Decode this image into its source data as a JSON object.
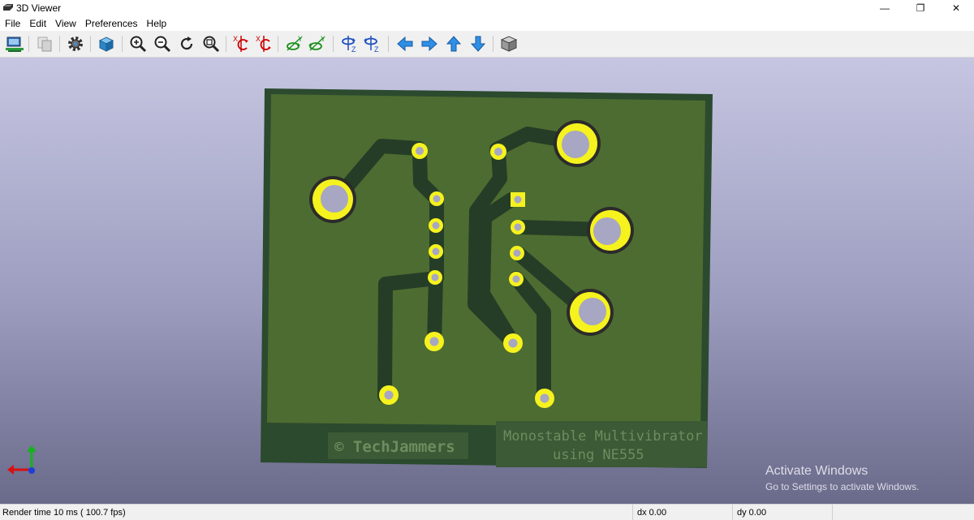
{
  "window": {
    "title": "3D Viewer",
    "minimize": "—",
    "restore": "❐",
    "close": "✕"
  },
  "menu": [
    "File",
    "Edit",
    "View",
    "Preferences",
    "Help"
  ],
  "toolbar": [
    {
      "name": "reload-board-button",
      "icon": "reload-board-icon"
    },
    {
      "name": "copy-image-button",
      "icon": "copy-icon"
    },
    {
      "name": "settings-button",
      "icon": "gear-icon"
    },
    {
      "name": "raytracing-button",
      "icon": "render-cube-icon"
    },
    {
      "name": "zoom-in-button",
      "icon": "zoom-in-icon"
    },
    {
      "name": "zoom-out-button",
      "icon": "zoom-out-icon"
    },
    {
      "name": "redraw-button",
      "icon": "refresh-icon"
    },
    {
      "name": "zoom-fit-button",
      "icon": "zoom-fit-icon"
    },
    {
      "name": "rotate-x-cw-button",
      "icon": "rotate-x-icon"
    },
    {
      "name": "rotate-x-ccw-button",
      "icon": "rotate-x-icon"
    },
    {
      "name": "rotate-y-cw-button",
      "icon": "rotate-y-icon"
    },
    {
      "name": "rotate-y-ccw-button",
      "icon": "rotate-y-icon"
    },
    {
      "name": "rotate-z-cw-button",
      "icon": "rotate-z-icon"
    },
    {
      "name": "rotate-z-ccw-button",
      "icon": "rotate-z-icon"
    },
    {
      "name": "move-left-button",
      "icon": "arrow-left-icon"
    },
    {
      "name": "move-right-button",
      "icon": "arrow-right-icon"
    },
    {
      "name": "move-up-button",
      "icon": "arrow-up-icon"
    },
    {
      "name": "move-down-button",
      "icon": "arrow-down-icon"
    },
    {
      "name": "ortho-toggle-button",
      "icon": "ortho-cube-icon"
    }
  ],
  "toolbar_axis_labels": {
    "x": "X",
    "y": "Y",
    "z": "Z"
  },
  "board": {
    "silkscreen_left": "© TechJammers",
    "silkscreen_right_line1": "Monostable Multivibrator",
    "silkscreen_right_line2": "using NE555",
    "colors": {
      "board_edge": "#2b4a2e",
      "copper": "#4d6c31",
      "trace": "#253d27",
      "pad": "#f5f21e",
      "hole": "#a7a6c3"
    }
  },
  "watermark": {
    "line1": "Activate Windows",
    "line2": "Go to Settings to activate Windows."
  },
  "status": {
    "render_time": "Render time 10 ms ( 100.7 fps)",
    "dx": "dx 0.00",
    "dy": "dy 0.00"
  }
}
